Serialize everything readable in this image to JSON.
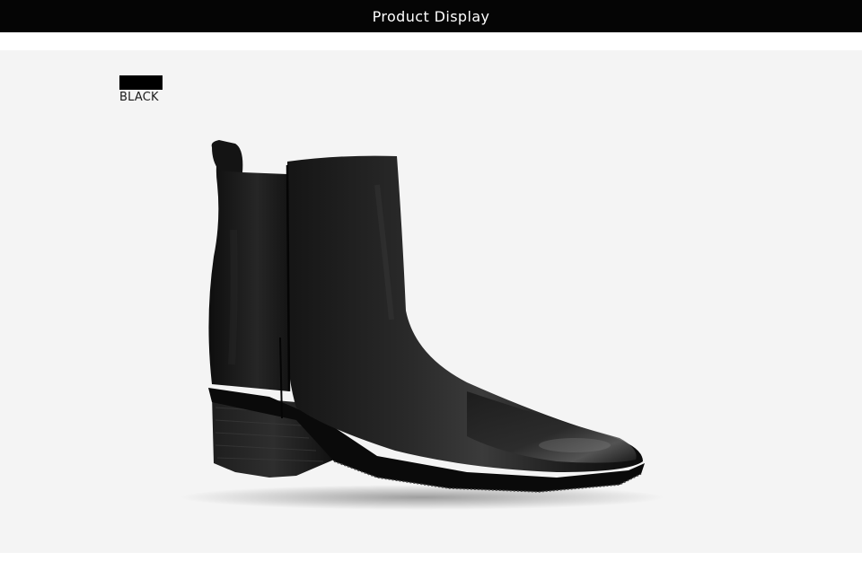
{
  "header": {
    "title": "Product Display"
  },
  "product": {
    "color_option": {
      "label": "BLACK",
      "swatch_color": "#000000"
    },
    "image_subject": "black-leather-ankle-boot"
  },
  "colors": {
    "header_bg": "#050505",
    "panel_bg": "#f4f4f4"
  }
}
